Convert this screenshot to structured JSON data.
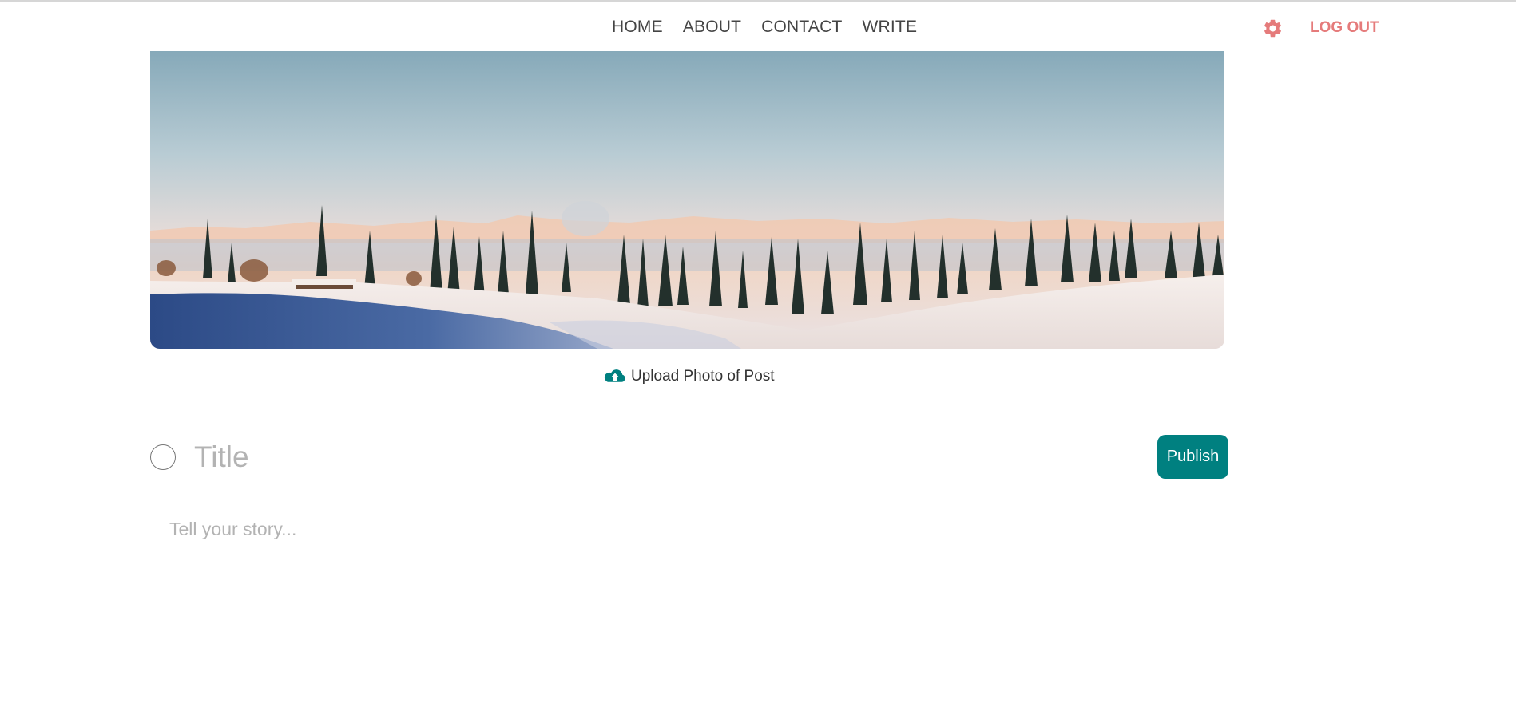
{
  "nav": {
    "links": [
      "HOME",
      "ABOUT",
      "CONTACT",
      "WRITE"
    ],
    "settings_icon": "gear-icon",
    "logout_label": "LOG OUT"
  },
  "hero": {
    "image": "snowy-mountain-pine-forest-photo"
  },
  "upload": {
    "icon": "cloud-upload-icon",
    "label": "Upload Photo of Post"
  },
  "form": {
    "title_placeholder": "Title",
    "title_value": "",
    "publish_label": "Publish",
    "story_placeholder": "Tell your story...",
    "story_value": ""
  },
  "colors": {
    "accent": "#008080",
    "logout": "#e57b7b",
    "placeholder": "#b3b3b3"
  }
}
